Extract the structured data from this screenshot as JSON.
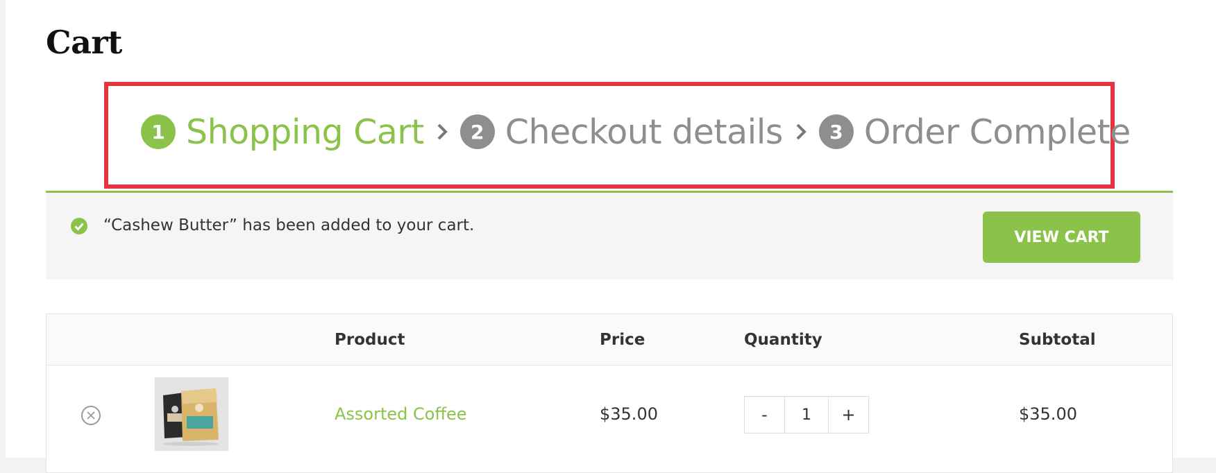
{
  "page": {
    "title": "Cart"
  },
  "steps": [
    {
      "number": "1",
      "label": "Shopping Cart",
      "active": true
    },
    {
      "number": "2",
      "label": "Checkout details",
      "active": false
    },
    {
      "number": "3",
      "label": "Order Complete",
      "active": false
    }
  ],
  "notice": {
    "message": "“Cashew Butter” has been added to your cart.",
    "button_label": "VIEW CART"
  },
  "cart": {
    "headers": {
      "product": "Product",
      "price": "Price",
      "quantity": "Quantity",
      "subtotal": "Subtotal"
    },
    "items": [
      {
        "name": "Assorted Coffee",
        "price": "$35.00",
        "quantity": "1",
        "subtotal": "$35.00"
      }
    ],
    "qty_minus": "-",
    "qty_plus": "+"
  },
  "colors": {
    "accent": "#8bc34a",
    "inactive_step": "#8e8e8e",
    "highlight_border": "#e3343f",
    "notice_bg": "#f5f5f5"
  },
  "icons": {
    "step_separator": "chevron-right-icon",
    "notice": "check-circle-icon",
    "remove": "close-circle-icon"
  }
}
